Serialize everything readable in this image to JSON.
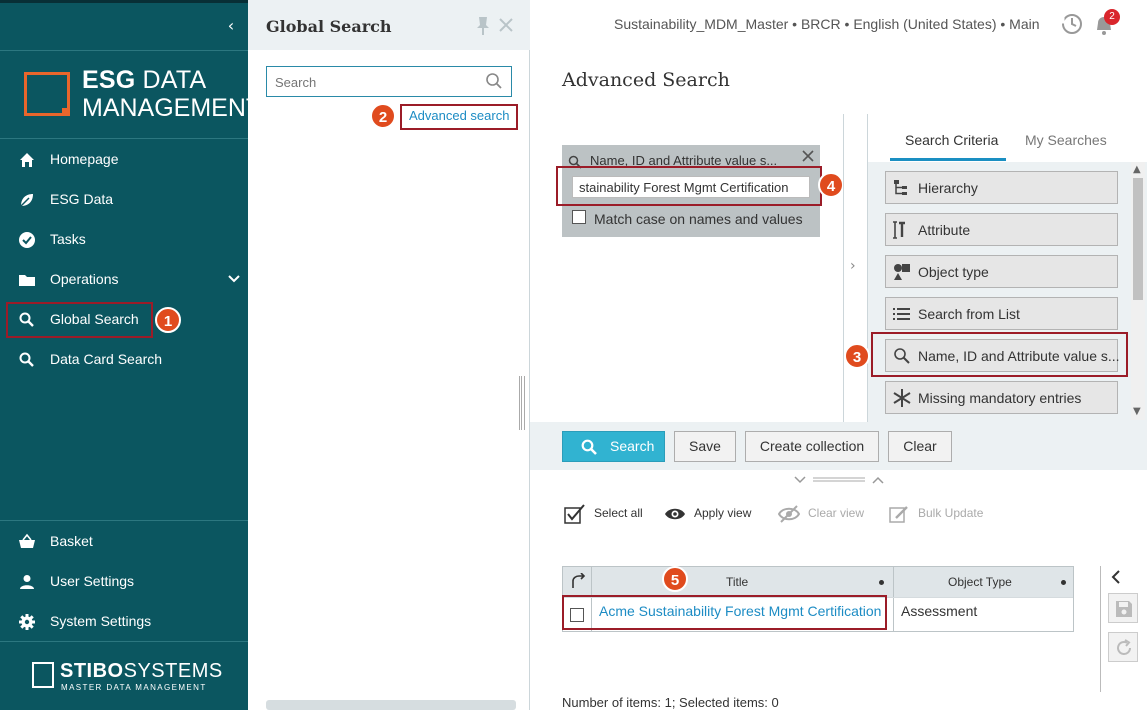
{
  "sidebar": {
    "logo_line1_bold": "ESG",
    "logo_line1_rest": " DATA",
    "logo_line2": "MANAGEMENT",
    "items": [
      {
        "label": "Homepage"
      },
      {
        "label": "ESG Data"
      },
      {
        "label": "Tasks"
      },
      {
        "label": "Operations"
      },
      {
        "label": "Global Search"
      },
      {
        "label": "Data Card Search"
      }
    ],
    "bottom_items": [
      {
        "label": "Basket"
      },
      {
        "label": "User Settings"
      },
      {
        "label": "System Settings"
      }
    ],
    "footer_brand_bold": "STIBO",
    "footer_brand_rest": "SYSTEMS",
    "footer_tagline": "MASTER DATA MANAGEMENT"
  },
  "global_search": {
    "title": "Global Search",
    "placeholder": "Search",
    "advanced_link": "Advanced search"
  },
  "header": {
    "context": "Sustainability_MDM_Master • BRCR • English (United States) • Main",
    "notification_count": "2"
  },
  "advanced": {
    "title": "Advanced Search",
    "criteria_title": "Name, ID and Attribute value s...",
    "criteria_value": "stainability Forest Mgmt Certification",
    "match_case_label": "Match case on names and values",
    "tabs": [
      {
        "label": "Search Criteria",
        "active": true
      },
      {
        "label": "My Searches",
        "active": false
      }
    ],
    "criteria_buttons": [
      {
        "label": "Hierarchy",
        "icon": "hierarchy-icon"
      },
      {
        "label": "Attribute",
        "icon": "attribute-icon"
      },
      {
        "label": "Object type",
        "icon": "object-type-icon"
      },
      {
        "label": "Search from List",
        "icon": "list-icon"
      },
      {
        "label": "Name, ID and Attribute value s...",
        "icon": "magnifier-icon"
      },
      {
        "label": "Missing mandatory entries",
        "icon": "asterisk-icon"
      }
    ],
    "buttons": {
      "search": "Search",
      "save": "Save",
      "create_collection": "Create collection",
      "clear": "Clear"
    },
    "toolbar": {
      "select_all": "Select all",
      "apply_view": "Apply view",
      "clear_view": "Clear view",
      "bulk_update": "Bulk Update"
    },
    "table": {
      "columns": [
        "Title",
        "Object Type"
      ],
      "rows": [
        {
          "title": "Acme Sustainability Forest Mgmt Certification",
          "object_type": "Assessment"
        }
      ]
    },
    "footer": "Number of items: 1; Selected items: 0"
  },
  "annotations": [
    "1",
    "2",
    "3",
    "4",
    "5"
  ],
  "colors": {
    "sidebar_bg": "#0b5660",
    "accent_orange": "#e8662c",
    "annotation_red": "#9b1c28",
    "primary_button": "#31b3d1",
    "link": "#1d8cc4"
  }
}
